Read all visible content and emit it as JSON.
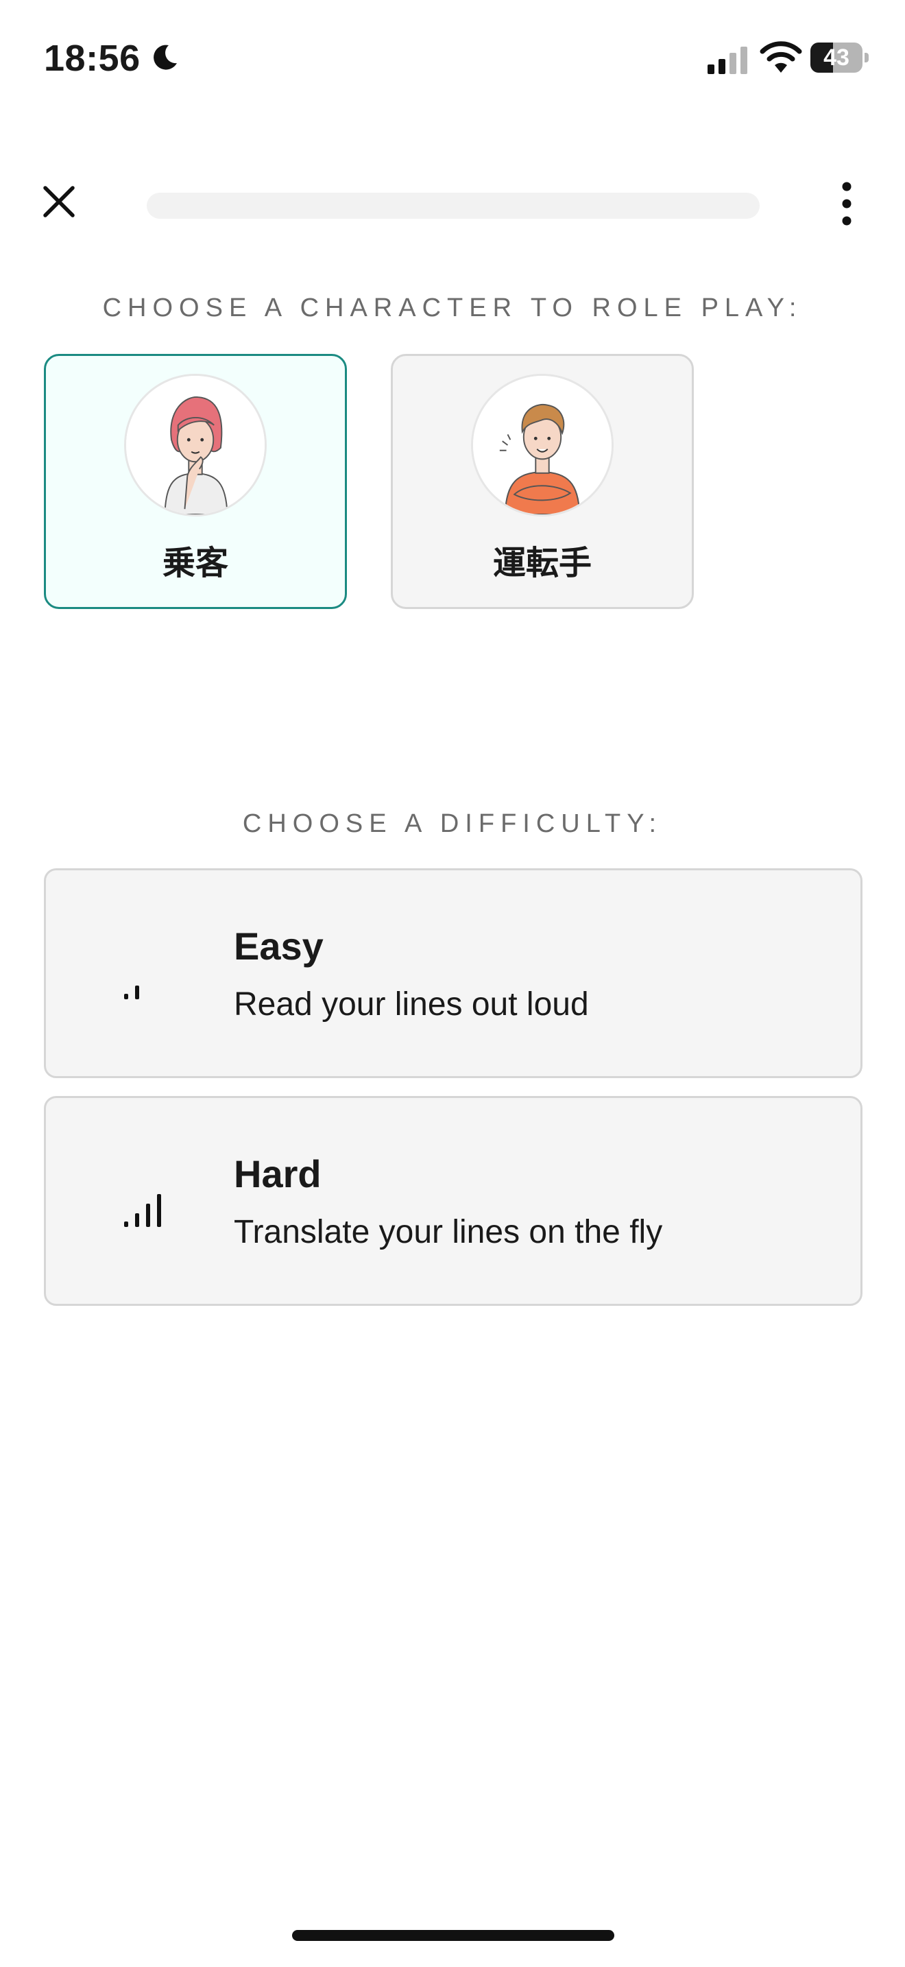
{
  "status_bar": {
    "time": "18:56",
    "moon_icon": "moon-icon",
    "signal_icon": "cellular-signal-icon",
    "wifi_icon": "wifi-icon",
    "battery_level": "43",
    "battery_fraction": 0.43
  },
  "top_bar": {
    "close_icon": "close-icon",
    "progress_fraction": 0,
    "more_icon": "more-vertical-icon"
  },
  "character_section": {
    "heading": "CHOOSE A CHARACTER TO ROLE PLAY:",
    "characters": [
      {
        "name": "乗客",
        "avatar": "woman-thinking-avatar",
        "selected": true
      },
      {
        "name": "運転手",
        "avatar": "man-arms-crossed-avatar",
        "selected": false
      }
    ]
  },
  "difficulty_section": {
    "heading": "CHOOSE A DIFFICULTY:",
    "options": [
      {
        "title": "Easy",
        "description": "Read your lines out loud",
        "icon": "signal-low-icon"
      },
      {
        "title": "Hard",
        "description": "Translate your lines on the fly",
        "icon": "signal-high-icon"
      }
    ]
  },
  "colors": {
    "accent": "#1b8b82",
    "selected_card_bg": "#f3fffd",
    "card_bg": "#f5f5f5",
    "card_border": "#d6d6d6",
    "heading_text": "#6b6b6b"
  }
}
